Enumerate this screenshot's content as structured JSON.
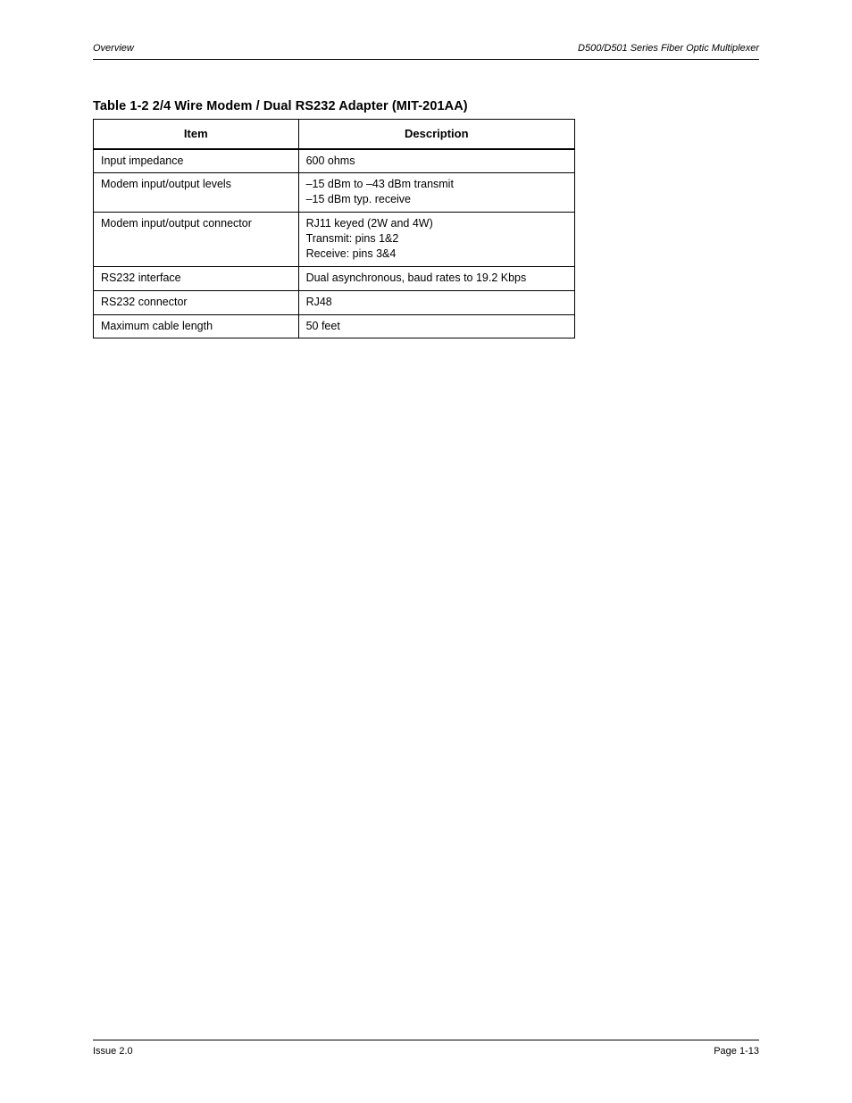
{
  "header": {
    "left": "Overview",
    "right": "D500/D501 Series Fiber Optic Multiplexer"
  },
  "table": {
    "title": "Table 1-2  2/4 Wire Modem / Dual RS232 Adapter (MIT-201AA)",
    "headers": {
      "col1": "Item",
      "col2": "Description"
    },
    "rows": [
      {
        "item": "Input impedance",
        "desc": "600 ohms"
      },
      {
        "item": "Modem input/output levels",
        "desc": "–15 dBm to –43 dBm transmit\n–15 dBm typ. receive"
      },
      {
        "item": "Modem input/output connector",
        "desc": "RJ11 keyed (2W and 4W)\nTransmit: pins 1&2\nReceive: pins 3&4"
      },
      {
        "item": "RS232 interface",
        "desc": "Dual asynchronous, baud rates to 19.2 Kbps"
      },
      {
        "item": "RS232 connector",
        "desc": "RJ48"
      },
      {
        "item": "Maximum cable length",
        "desc": "50 feet"
      }
    ]
  },
  "footer": {
    "left": "Issue 2.0",
    "center": "",
    "right_label": "Page ",
    "right_page": "1-13"
  }
}
